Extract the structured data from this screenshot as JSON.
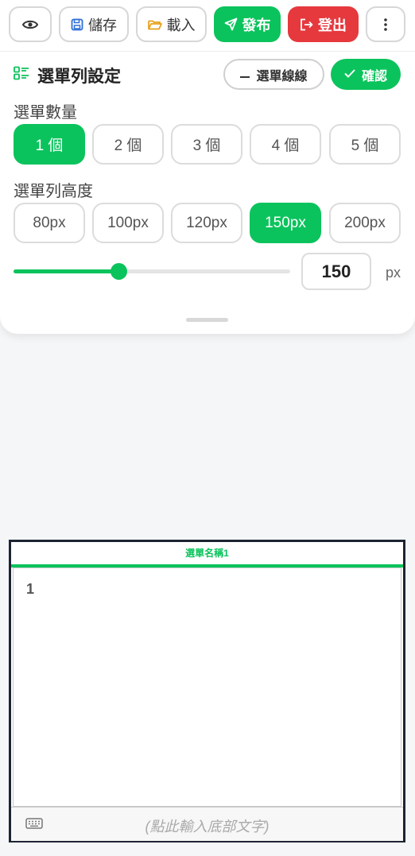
{
  "toolbar": {
    "preview_icon": "eye-icon",
    "save_label": "儲存",
    "load_label": "載入",
    "publish_label": "發布",
    "logout_label": "登出",
    "more_icon": "more-vertical-icon"
  },
  "settings": {
    "title": "選單列設定",
    "title_icon": "list-settings-icon",
    "gridlines_button": "選單線線",
    "confirm_button": "確認",
    "count_label": "選單數量",
    "count_options": [
      "1 個",
      "2 個",
      "3 個",
      "4 個",
      "5 個"
    ],
    "count_selected": "1 個",
    "height_label": "選單列高度",
    "height_options": [
      "80px",
      "100px",
      "120px",
      "150px",
      "200px"
    ],
    "height_selected": "150px",
    "slider_value_fraction": 0.38,
    "height_value": "150",
    "height_unit": "px"
  },
  "menu": {
    "tab_label": "選單名稱1",
    "area_number": "1",
    "bottom_placeholder": "(點此輸入底部文字)",
    "keyboard_icon": "keyboard-icon"
  },
  "colors": {
    "accent_green": "#0bc35c",
    "logout_red": "#e5393e",
    "menu_border": "#1d2433"
  }
}
